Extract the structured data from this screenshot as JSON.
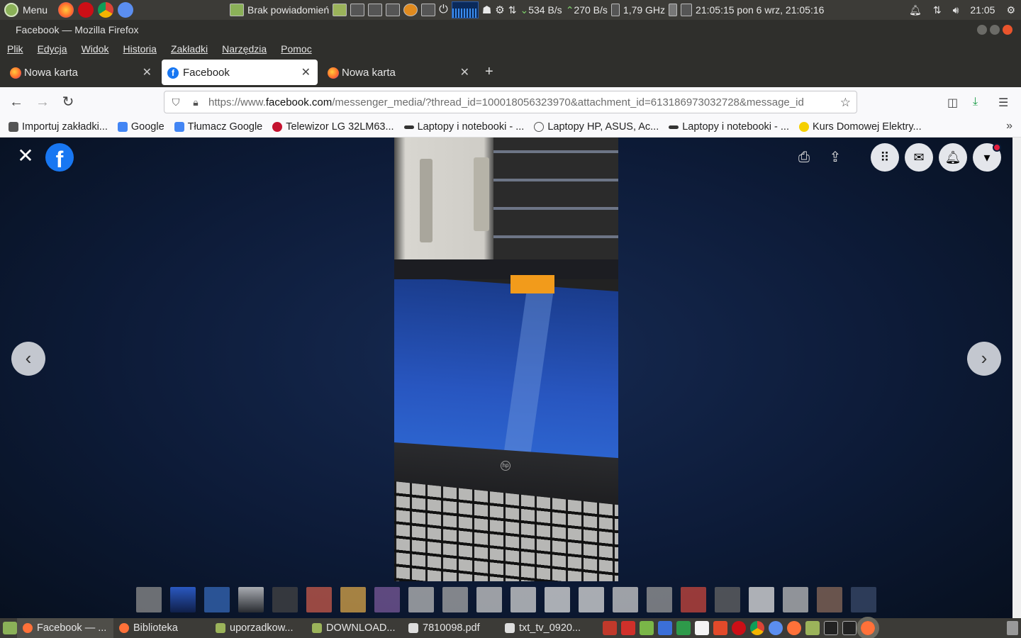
{
  "system_panel": {
    "menu_label": "Menu",
    "notifications_label": "Brak powiadomień",
    "net_down": "534 B/s",
    "net_up": "270 B/s",
    "cpu_freq": "1,79 GHz",
    "datetime_text": "21:05:15 pon  6 wrz, 21:05:16",
    "clock": "21:05"
  },
  "window": {
    "title": "Facebook — Mozilla Firefox"
  },
  "menubar": {
    "items": [
      "Plik",
      "Edycja",
      "Widok",
      "Historia",
      "Zakładki",
      "Narzędzia",
      "Pomoc"
    ]
  },
  "tabs": [
    {
      "label": "Nowa karta",
      "active": false
    },
    {
      "label": "Facebook",
      "active": true
    },
    {
      "label": "Nowa karta",
      "active": false
    }
  ],
  "urlbar": {
    "prefix": "https://www.",
    "domain": "facebook.com",
    "path": "/messenger_media/?thread_id=100018056323970&attachment_id=613186973032728&message_id"
  },
  "bookmarks": [
    {
      "label": "Importuj zakładki...",
      "color": "#555555"
    },
    {
      "label": "Google",
      "color": "#4285f4"
    },
    {
      "label": "Tłumacz Google",
      "color": "#4285f4"
    },
    {
      "label": "Telewizor LG 32LM63...",
      "color": "#c4122f"
    },
    {
      "label": "Laptopy i notebooki - ...",
      "color": "#333333"
    },
    {
      "label": "Laptopy HP, ASUS, Ac...",
      "color": "#555555"
    },
    {
      "label": "Laptopy i notebooki - ...",
      "color": "#333333"
    },
    {
      "label": "Kurs Domowej Elektry...",
      "color": "#f5d000"
    }
  ],
  "viewer": {
    "logo_letter": "f",
    "close_glyph": "✕",
    "prev_glyph": "‹",
    "next_glyph": "›"
  },
  "taskbar": {
    "items": [
      {
        "label": "Facebook — ...",
        "icon_color": "#ff7139"
      },
      {
        "label": "Biblioteka",
        "icon_color": "#ff7139"
      },
      {
        "label": "uporzadkow...",
        "icon_color": "#9bb35a"
      },
      {
        "label": "DOWNLOAD...",
        "icon_color": "#9bb35a"
      },
      {
        "label": "7810098.pdf",
        "icon_color": "#dddddd"
      },
      {
        "label": "txt_tv_0920...",
        "icon_color": "#dddddd"
      }
    ]
  }
}
